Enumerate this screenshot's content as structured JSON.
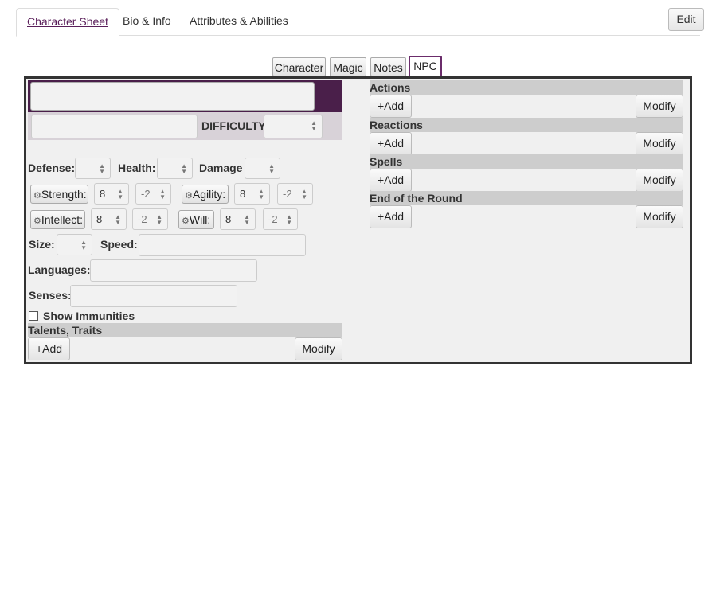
{
  "top_tabs": [
    "Character Sheet",
    "Bio & Info",
    "Attributes & Abilities"
  ],
  "edit_label": "Edit",
  "sheet_tabs": [
    "Character",
    "Magic",
    "Notes",
    "NPC"
  ],
  "header": {
    "difficulty_label": "DIFFICULTY"
  },
  "stats": {
    "defense_label": "Defense:",
    "health_label": "Health:",
    "damage_label": "Damage",
    "strength": {
      "label": "Strength:",
      "value": "8",
      "mod": "-2"
    },
    "agility": {
      "label": "Agility:",
      "value": "8",
      "mod": "-2"
    },
    "intellect": {
      "label": "Intellect:",
      "value": "8",
      "mod": "-2"
    },
    "will": {
      "label": "Will:",
      "value": "8",
      "mod": "-2"
    },
    "size_label": "Size:",
    "speed_label": "Speed:",
    "languages_label": "Languages:",
    "senses_label": "Senses:",
    "show_immunities_label": "Show Immunities"
  },
  "sections": {
    "talents": "Talents, Traits",
    "actions": "Actions",
    "reactions": "Reactions",
    "spells": "Spells",
    "end_round": "End of the Round"
  },
  "buttons": {
    "add": "+Add",
    "modify": "Modify"
  },
  "die_icon": "d20-icon"
}
